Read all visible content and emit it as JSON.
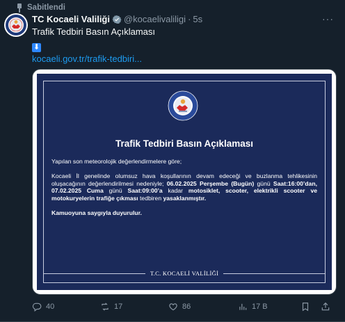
{
  "pinned": {
    "label": "Sabitlendi"
  },
  "post": {
    "author_name": "TC Kocaeli Valiliği",
    "handle": "@kocaelivaliligi",
    "separator": "·",
    "time": "5s",
    "text": "Trafik Tedbiri Basın Açıklaması",
    "emoji": "⬇",
    "link": "kocaeli.gov.tr/trafik-tedbiri..."
  },
  "media": {
    "title": "Trafik Tedbiri Basın Açıklaması",
    "intro": "Yapılan son meteorolojik değerlendirmelere göre;",
    "p1_a": "Kocaeli İl genelinde olumsuz hava koşullarının devam edeceği ve buzlanma tehlikesinin oluşacağının değerlendirilmesi nedeniyle; ",
    "p1_b": "06.02.2025 Perşembe (Bugün)",
    "p1_c": " günü ",
    "p1_d": "Saat:16:00’dan, 07.02.2025 Cuma",
    "p1_e": " günü ",
    "p1_f": "Saat:09:00’a",
    "p1_g": " kadar ",
    "p1_h": "motosiklet, scooter, elektrikli scooter ve motokuryelerin trafiğe çıkması",
    "p1_i": " tedbiren ",
    "p1_j": "yasaklanmıştır.",
    "closing": "Kamuoyuna saygıyla duyurulur.",
    "footer": "T.C. KOCAELİ VALİLİĞİ"
  },
  "actions": {
    "replies": "40",
    "reposts": "17",
    "likes": "86",
    "views": "17 B"
  },
  "colors": {
    "background": "#15202b",
    "accent": "#1d9bf0",
    "muted": "#8b98a5",
    "card": "#1b2a5a",
    "verified_gray": "#829aab"
  },
  "icons": [
    "pin-icon",
    "avatar-emblem",
    "verified-badge-icon",
    "more-icon",
    "reply-icon",
    "repost-icon",
    "like-icon",
    "views-icon",
    "bookmark-icon",
    "share-icon"
  ]
}
